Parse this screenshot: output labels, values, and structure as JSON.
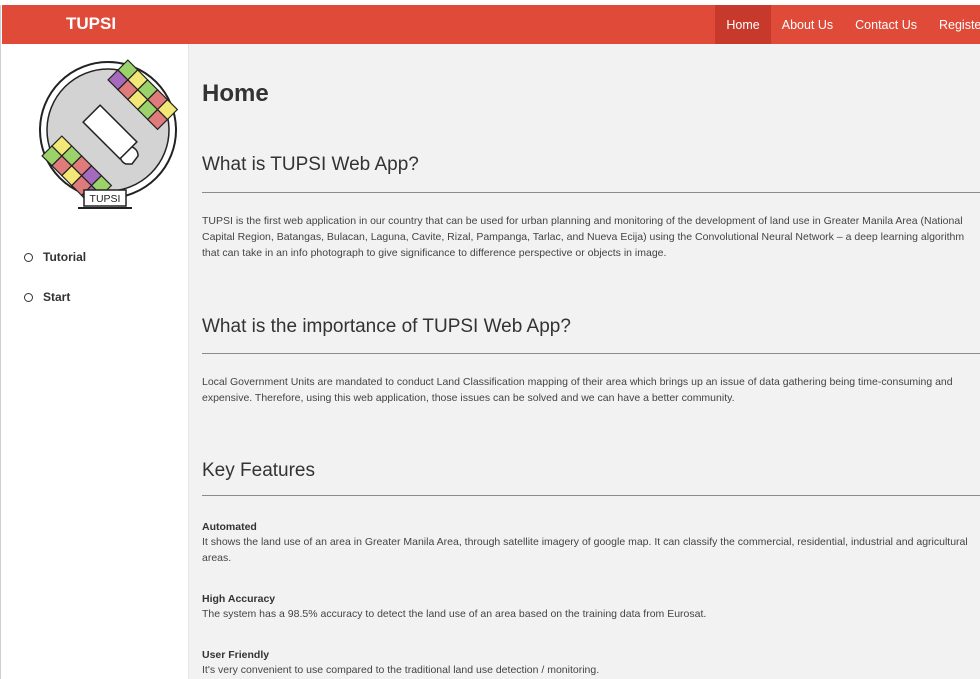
{
  "navbar": {
    "brand": "TUPSI",
    "items": [
      {
        "label": "Home",
        "active": true
      },
      {
        "label": "About Us",
        "active": false
      },
      {
        "label": "Contact Us",
        "active": false
      },
      {
        "label": "Registe",
        "active": false
      }
    ]
  },
  "sidebar": {
    "logo_text": "TUPSI",
    "logo_icon": "satellite-icon",
    "items": [
      {
        "label": "Tutorial",
        "icon": "radio-circle-icon"
      },
      {
        "label": "Start",
        "icon": "radio-circle-icon"
      }
    ]
  },
  "main": {
    "title": "Home",
    "sections": [
      {
        "heading": "What is TUPSI Web App?",
        "text": "TUPSI is the first web application in our country that can be used for urban planning and monitoring of the development of land use in Greater Manila Area (National Capital Region, Batangas, Bulacan, Laguna, Cavite, Rizal, Pampanga, Tarlac, and Nueva Ecija) using the Convolutional Neural Network – a deep learning algorithm that can take in an info photograph to give significance to difference perspective or objects in image."
      },
      {
        "heading": "What is the importance of TUPSI Web App?",
        "text": "Local Government Units are mandated to conduct Land Classification mapping of their area which brings up an issue of data gathering being time-consuming and expensive. Therefore, using this web application, those issues can be solved and we can have a better community."
      },
      {
        "heading": "Key Features"
      }
    ],
    "features": [
      {
        "title": "Automated",
        "desc": "It shows the land use of an area in Greater Manila Area, through satellite imagery of google map. It can classify the commercial, residential, industrial and agricultural areas."
      },
      {
        "title": "High Accuracy",
        "desc": "The system has a 98.5% accuracy to detect the land use of an area based on the training data from Eurosat."
      },
      {
        "title": "User Friendly",
        "desc": "It's very convenient to use compared to the traditional land use detection / monitoring."
      }
    ]
  },
  "colors": {
    "navbar": "#e04a38",
    "nav_active": "#c73a2b",
    "main_bg": "#f2f2f2"
  }
}
